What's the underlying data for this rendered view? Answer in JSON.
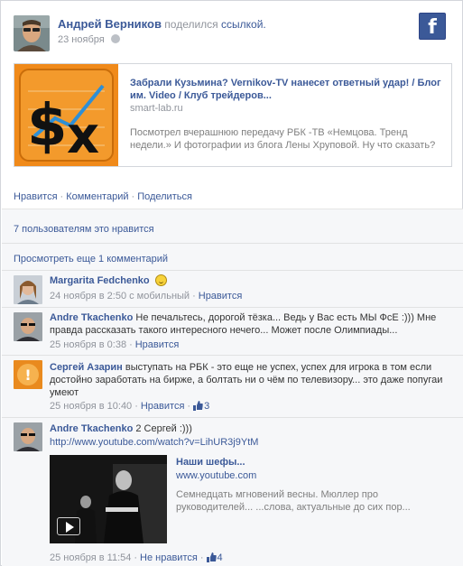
{
  "post": {
    "author": "Андрей Верников",
    "action_text": "поделился",
    "action_link": "ссылкой.",
    "date": "23 ноября"
  },
  "share": {
    "title": "Забрали Кузьмина? Vernikov-TV нанесет ответный удар! / Блог им. Video / Клуб трейдеров...",
    "domain": "smart-lab.ru",
    "description": "Посмотрел вчерашнюю передачу РБК -ТВ «Немцова. Тренд недели.» И фотографии из блога Лены Хруповой. Ну что сказать?"
  },
  "actions": {
    "like": "Нравится",
    "comment": "Комментарий",
    "share": "Поделиться"
  },
  "likes_summary": "7 пользователям это нравится",
  "more_comments": "Просмотреть еще 1 комментарий",
  "comments": [
    {
      "name": "Margarita Fedchenko",
      "text": "",
      "meta": "24 ноября в 2:50 с мобильный",
      "like_action": "Нравится",
      "likes": ""
    },
    {
      "name": "Andre Tkachenko",
      "text": "Не печальтесь, дорогой тёзка... Ведь у Вас есть МЫ ФсЕ :))) Мне правда рассказать такого интересного нечего... Может после Олимпиады...",
      "meta": "25 ноября в 0:38",
      "like_action": "Нравится",
      "likes": ""
    },
    {
      "name": "Сергей Азарин",
      "text": "выступать на РБК - это еще не успех, успех для игрока в том если достойно заработать на бирже, а болтать ни о чём по телевизору... это даже попугаи умеют",
      "meta": "25 ноября в 10:40",
      "like_action": "Нравится",
      "likes": "3"
    },
    {
      "name": "Andre Tkachenko",
      "text": "2 Сергей :)))",
      "url": "http://www.youtube.com/watch?v=LihUR3j9YtM",
      "meta": "25 ноября в 11:54",
      "like_action": "Не нравится",
      "likes": "4"
    }
  ],
  "video": {
    "title": "Наши шефы...",
    "domain": "www.youtube.com",
    "description": "Семнедцать мгновений весны. Мюллер про руководителей... ...слова, актуальные до сих пор..."
  },
  "colors": {
    "link": "#3b5998",
    "meta": "#90949c",
    "section_bg": "#f6f7f9",
    "thumb_orange": "#f08a1a"
  },
  "icons": {
    "brand": "facebook-icon",
    "privacy": "globe-icon",
    "like": "thumbs-up-icon",
    "emoticon": "smile-icon",
    "play": "play-icon"
  },
  "brand_logo": "f"
}
